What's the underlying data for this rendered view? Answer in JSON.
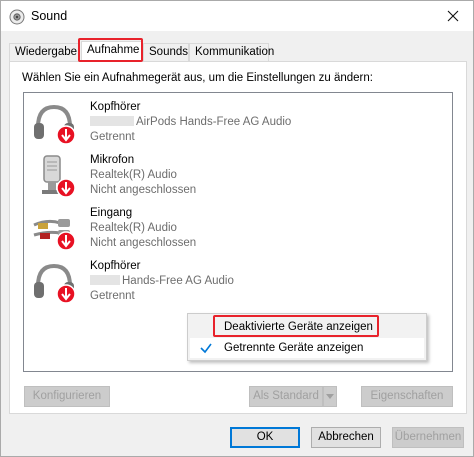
{
  "window": {
    "title": "Sound"
  },
  "tabs": [
    {
      "label": "Wiedergabe"
    },
    {
      "label": "Aufnahme"
    },
    {
      "label": "Sounds"
    },
    {
      "label": "Kommunikation"
    }
  ],
  "prompt": "Wählen Sie ein Aufnahmegerät aus, um die Einstellungen zu ändern:",
  "devices": [
    {
      "name": "Kopfhörer",
      "description": "AirPods Hands-Free AG Audio",
      "status": "Getrennt",
      "icon": "headphones-icon"
    },
    {
      "name": "Mikrofon",
      "description": "Realtek(R) Audio",
      "status": "Nicht angeschlossen",
      "icon": "microphone-icon"
    },
    {
      "name": "Eingang",
      "description": "Realtek(R) Audio",
      "status": "Nicht angeschlossen",
      "icon": "line-in-cable-icon"
    },
    {
      "name": "Kopfhörer",
      "description": "Hands-Free AG Audio",
      "status": "Getrennt",
      "icon": "headphones-icon"
    }
  ],
  "context_menu": {
    "items": [
      {
        "label": "Deaktivierte Geräte anzeigen",
        "checked": false
      },
      {
        "label": "Getrennte Geräte anzeigen",
        "checked": true
      }
    ]
  },
  "panel_buttons": {
    "configure": "Konfigurieren",
    "set_default": "Als Standard",
    "properties": "Eigenschaften"
  },
  "dialog_buttons": {
    "ok": "OK",
    "cancel": "Abbrechen",
    "apply": "Übernehmen"
  },
  "colors": {
    "highlight": "#e8222b",
    "accent": "#0078d7",
    "status_error": "#e81123"
  }
}
